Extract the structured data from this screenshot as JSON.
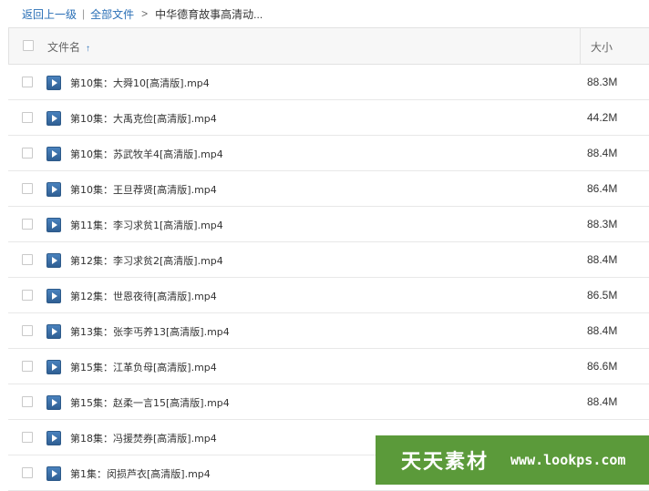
{
  "breadcrumb": {
    "back": "返回上一级",
    "separator": "|",
    "all_files": "全部文件",
    "arrow": ">",
    "current": "中华德育故事高清动..."
  },
  "header": {
    "name_label": "文件名",
    "sort_icon": "↑",
    "size_label": "大小"
  },
  "files": [
    {
      "name": "第10集：大舜10[高清版].mp4",
      "size": "88.3M"
    },
    {
      "name": "第10集：大禹克俭[高清版].mp4",
      "size": "44.2M"
    },
    {
      "name": "第10集：苏武牧羊4[高清版].mp4",
      "size": "88.4M"
    },
    {
      "name": "第10集：王旦荐贤[高清版].mp4",
      "size": "86.4M"
    },
    {
      "name": "第11集：李习求贫1[高清版].mp4",
      "size": "88.3M"
    },
    {
      "name": "第12集：李习求贫2[高清版].mp4",
      "size": "88.4M"
    },
    {
      "name": "第12集：世恩夜待[高清版].mp4",
      "size": "86.5M"
    },
    {
      "name": "第13集：张李丐养13[高清版].mp4",
      "size": "88.4M"
    },
    {
      "name": "第15集：江革负母[高清版].mp4",
      "size": "86.6M"
    },
    {
      "name": "第15集：赵柔一言15[高清版].mp4",
      "size": "88.4M"
    },
    {
      "name": "第18集：冯援焚券[高清版].mp4",
      "size": ""
    },
    {
      "name": "第1集：闵损芦衣[高清版].mp4",
      "size": ""
    }
  ],
  "watermark": {
    "brand": "天天素材",
    "url": "www.lookps.com"
  }
}
